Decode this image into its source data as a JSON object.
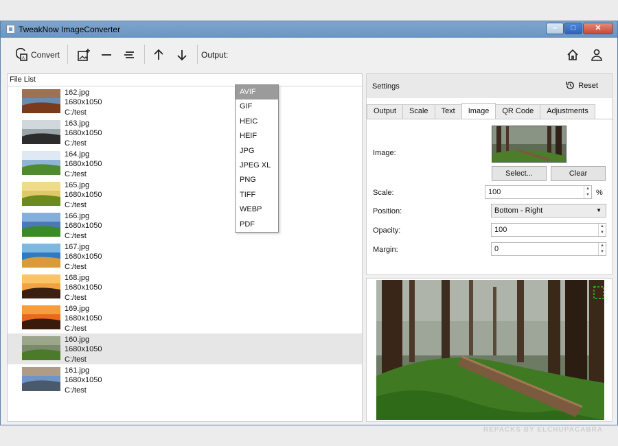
{
  "window": {
    "title": "TweakNow ImageConverter"
  },
  "toolbar": {
    "convert_label": "Convert",
    "output_label": "Output:"
  },
  "output_dropdown": {
    "selected": "AVIF",
    "options": [
      "AVIF",
      "GIF",
      "HEIC",
      "HEIF",
      "JPG",
      "JPEG XL",
      "PNG",
      "TIFF",
      "WEBP",
      "PDF"
    ]
  },
  "file_list": {
    "header": "File List",
    "items": [
      {
        "name": "162.jpg",
        "size": "1680x1050",
        "path": "C:/test"
      },
      {
        "name": "163.jpg",
        "size": "1680x1050",
        "path": "C:/test"
      },
      {
        "name": "164.jpg",
        "size": "1680x1050",
        "path": "C:/test"
      },
      {
        "name": "165.jpg",
        "size": "1680x1050",
        "path": "C:/test"
      },
      {
        "name": "166.jpg",
        "size": "1680x1050",
        "path": "C:/test"
      },
      {
        "name": "167.jpg",
        "size": "1680x1050",
        "path": "C:/test"
      },
      {
        "name": "168.jpg",
        "size": "1680x1050",
        "path": "C:/test"
      },
      {
        "name": "169.jpg",
        "size": "1680x1050",
        "path": "C:/test"
      },
      {
        "name": "160.jpg",
        "size": "1680x1050",
        "path": "C:/test"
      },
      {
        "name": "161.jpg",
        "size": "1680x1050",
        "path": "C:/test"
      }
    ]
  },
  "settings": {
    "label": "Settings",
    "reset_label": "Reset",
    "tabs": [
      "Output",
      "Scale",
      "Text",
      "Image",
      "QR Code",
      "Adjustments"
    ],
    "active_tab": "Image",
    "image_label": "Image:",
    "select_label": "Select...",
    "clear_label": "Clear",
    "scale_label": "Scale:",
    "scale_value": "100",
    "scale_unit": "%",
    "position_label": "Position:",
    "position_value": "Bottom - Right",
    "opacity_label": "Opacity:",
    "opacity_value": "100",
    "margin_label": "Margin:",
    "margin_value": "0"
  },
  "watermark": "REPACKS BY ELCHUPACABRA"
}
